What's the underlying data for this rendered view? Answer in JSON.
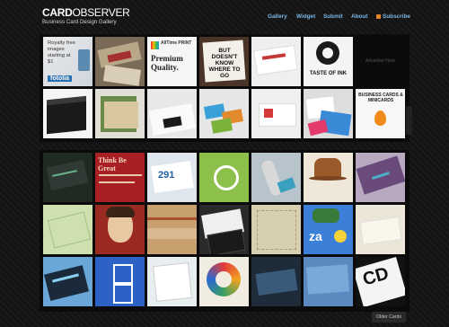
{
  "header": {
    "logo_bold": "CARD",
    "logo_light": "OBSERVER",
    "tagline": "Business Card Design Gallery"
  },
  "nav": {
    "items": [
      "Gallery",
      "Widget",
      "Submit",
      "About",
      "Subscribe"
    ]
  },
  "tiles_text": {
    "royalty": "Royalty free images starting at $1",
    "fotolia": "fotolia",
    "alltime": "AllTime PRINT",
    "premium": "Premium Quality.",
    "dontknow": "BUT DOESN'T KNOW WHERE TO GO",
    "taste": "TASTE OF INK",
    "ad": "Advertise Here",
    "businesscards": "BUSINESS CARDS & MINICARDS",
    "thinkbig": "Think Be Great",
    "num": "291",
    "za": "za",
    "cd": "CD"
  },
  "pagination": {
    "older": "Older Cards"
  },
  "colors": {
    "nav_link": "#7ab8e8",
    "background": "#141414",
    "rss": "#e8862a"
  }
}
